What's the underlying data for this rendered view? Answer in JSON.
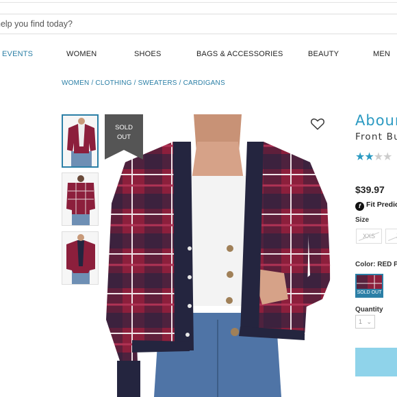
{
  "search": {
    "placeholder_text": "help you find today?"
  },
  "nav": {
    "items": [
      "EVENTS",
      "WOMEN",
      "SHOES",
      "BAGS & ACCESSORIES",
      "BEAUTY",
      "MEN"
    ],
    "active_color": "#2b7fa6"
  },
  "breadcrumb": {
    "items": [
      "WOMEN",
      "CLOTHING",
      "SWEATERS",
      "CARDIGANS"
    ],
    "separator": "/"
  },
  "product": {
    "title": "Abour",
    "subtitle": "Front Bu",
    "rating_filled": 2,
    "price": "$39.97",
    "fit_text": "Fit Predic",
    "size_label": "Size",
    "sizes": [
      "XXS",
      "X"
    ],
    "color_label": "Color: RED P",
    "swatch_sold_out": "SOLD OUT",
    "quantity_label": "Quantity",
    "quantity_value": "1"
  },
  "image": {
    "sold_out_line1": "SOLD",
    "sold_out_line2": "OUT"
  },
  "colors": {
    "accent": "#2b9ac2",
    "link": "#2b7fa6",
    "sweater_red": "#8c1f3c",
    "sweater_navy": "#24253f"
  }
}
